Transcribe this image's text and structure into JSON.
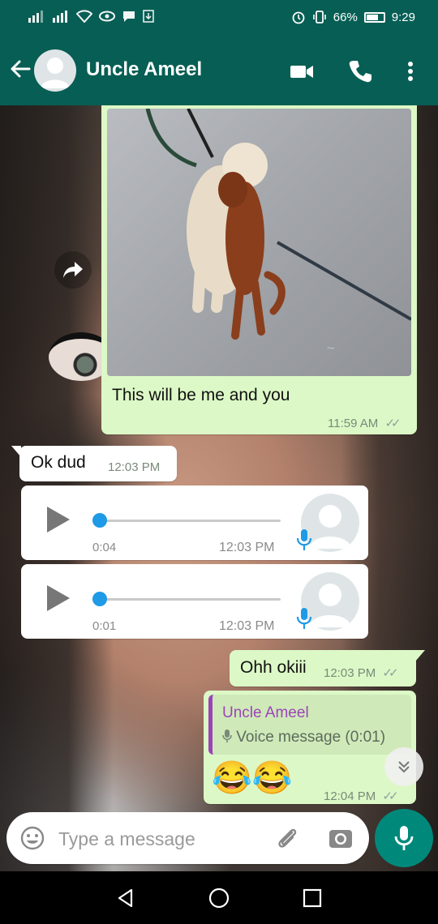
{
  "status_bar": {
    "left_icons": [
      "signal-icon",
      "signal-icon",
      "wifi-icon",
      "eye-icon",
      "chat-icon",
      "download-icon"
    ],
    "battery": "66%",
    "time": "9:29"
  },
  "header": {
    "contact_name": "Uncle Ameel",
    "icons": [
      "back-arrow-icon",
      "avatar",
      "video-call-icon",
      "phone-icon",
      "more-vert-icon"
    ]
  },
  "messages": [
    {
      "type": "image",
      "direction": "outgoing",
      "caption": "This will be me and you",
      "time": "11:59 AM",
      "status": "read"
    },
    {
      "type": "text",
      "direction": "incoming",
      "text": "Ok dud",
      "time": "12:03 PM"
    },
    {
      "type": "voice",
      "direction": "incoming",
      "duration": "0:04",
      "time": "12:03 PM"
    },
    {
      "type": "voice",
      "direction": "incoming",
      "duration": "0:01",
      "time": "12:03 PM"
    },
    {
      "type": "text",
      "direction": "outgoing",
      "text": "Ohh okiii",
      "time": "12:03 PM",
      "status": "read"
    },
    {
      "type": "reply",
      "direction": "outgoing",
      "quoted_name": "Uncle Ameel",
      "quoted_text": "Voice message (0:01)",
      "text": "😂😂",
      "time": "12:04 PM",
      "status": "read"
    }
  ],
  "input": {
    "placeholder": "Type a message"
  },
  "colors": {
    "header": "#075e54",
    "outgoing_bubble": "#dcf8c6",
    "incoming_bubble": "#ffffff",
    "accent": "#00897b",
    "play_dot": "#1e9ae6",
    "quote_name": "#9c44b8"
  }
}
